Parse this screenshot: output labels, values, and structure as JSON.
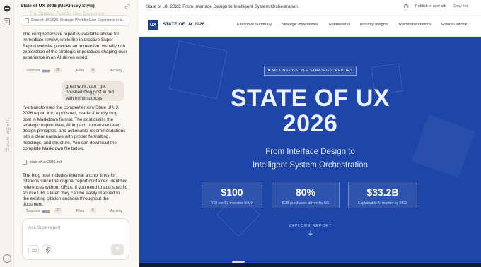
{
  "rail": {
    "brand": "Superagent"
  },
  "chat": {
    "title": "State of UX 2026 (McKinsey Style)",
    "prev_ghost": "The Strategic Pivot for User Experience",
    "artifact_card": "State of UX 2026: Strategic Pivot for User Experience in a...",
    "para1": "The comprehensive report is available above for immediate review, while the interactive Super Report website provides an immersive, visually rich exploration of the strategic imperatives shaping user experience in an AI-driven world.",
    "meta1": {
      "sources": "Sources",
      "sources_count": "35",
      "files": "Files",
      "files_count": "6",
      "activity": "Activity"
    },
    "user_message": "great work, can i get polished blog post in md with inline sources",
    "para2": "I've transformed the comprehensive State of UX 2026 report into a polished, reader-friendly blog post in Markdown format. The post distills the strategic imperatives, AI impact, human-centered design principles, and actionable recommendations into a clear narrative with proper formatting, headings, and structure. You can download the complete Markdown file below.",
    "file_name": "state-of-ux-2026.md",
    "para3": "The blog post includes internal anchor links for citations since the original report contained identifier references without URLs. If you need to add specific source URLs later, they can be easily mapped to the existing citation anchors throughout the document.",
    "meta2": {
      "sources": "Sources",
      "sources_count": "37",
      "files": "Files",
      "files_count": "6",
      "activity": "Activity"
    },
    "composer_placeholder": "Ask Superagent"
  },
  "preview": {
    "title": "State of UX 2026: From Interface Design to Intelligent System Orchestration",
    "publish": "Publish in new tab",
    "copy": "Copy link"
  },
  "site": {
    "logo": "UX",
    "name": "STATE OF UX 2026",
    "nav": [
      "Executive Summary",
      "Strategic Imperatives",
      "Frameworks",
      "Industry Insights",
      "Recommendations",
      "Future Outlook"
    ],
    "tag": "MCKINSEY-STYLE STRATEGIC REPORT",
    "headline1": "STATE OF UX",
    "headline2": "2026",
    "subtitle1": "From Interface Design to",
    "subtitle2": "Intelligent System Orchestration",
    "stats": [
      {
        "value": "$100",
        "label": "ROI per $1 invested in UX"
      },
      {
        "value": "80%",
        "label": "B2B purchases driven by UX"
      },
      {
        "value": "$33.2B",
        "label": "Explainable AI market by 2032"
      }
    ],
    "explore": "EXPLORE REPORT"
  },
  "colors": {
    "hero": "#1e46a8",
    "logo_bg": "#1d3d8f",
    "panel_bg": "#fbf8f3"
  }
}
